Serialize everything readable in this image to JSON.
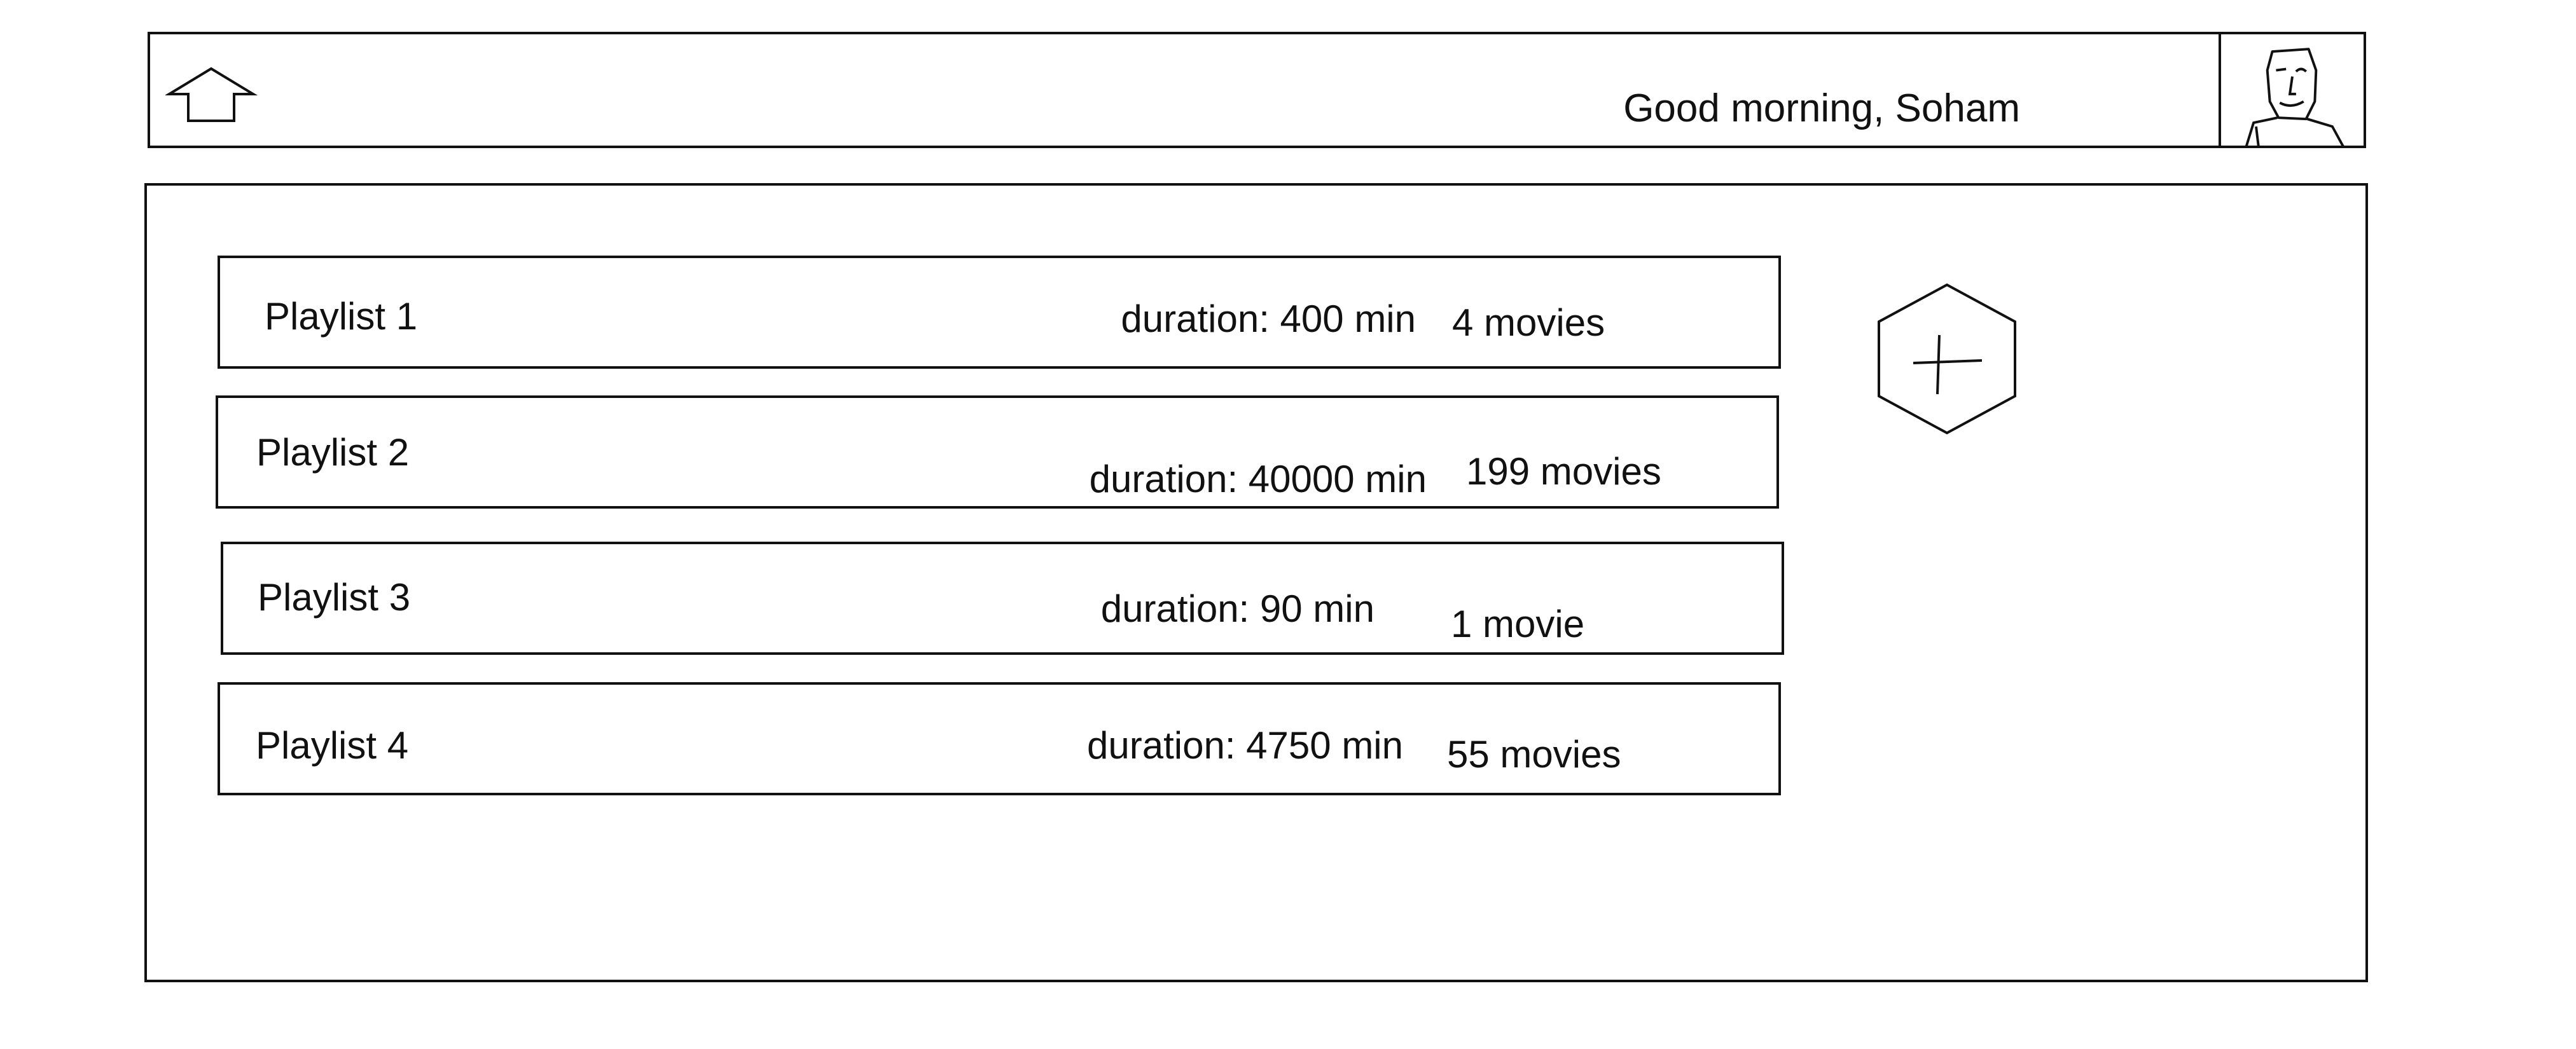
{
  "header": {
    "home_icon": "home-arrow-icon",
    "greeting": "Good morning, Soham",
    "avatar_icon": "user-avatar-sketch"
  },
  "playlists": [
    {
      "name": "Playlist 1",
      "duration": "duration: 400 min",
      "count": "4 movies"
    },
    {
      "name": "Playlist 2",
      "duration": "duration: 40000 min",
      "count": "199 movies"
    },
    {
      "name": "Playlist 3",
      "duration": "duration: 90 min",
      "count": "1 movie"
    },
    {
      "name": "Playlist 4",
      "duration": "duration: 4750 min",
      "count": "55 movies"
    }
  ],
  "add_button": {
    "icon": "hexagon-plus-icon"
  }
}
